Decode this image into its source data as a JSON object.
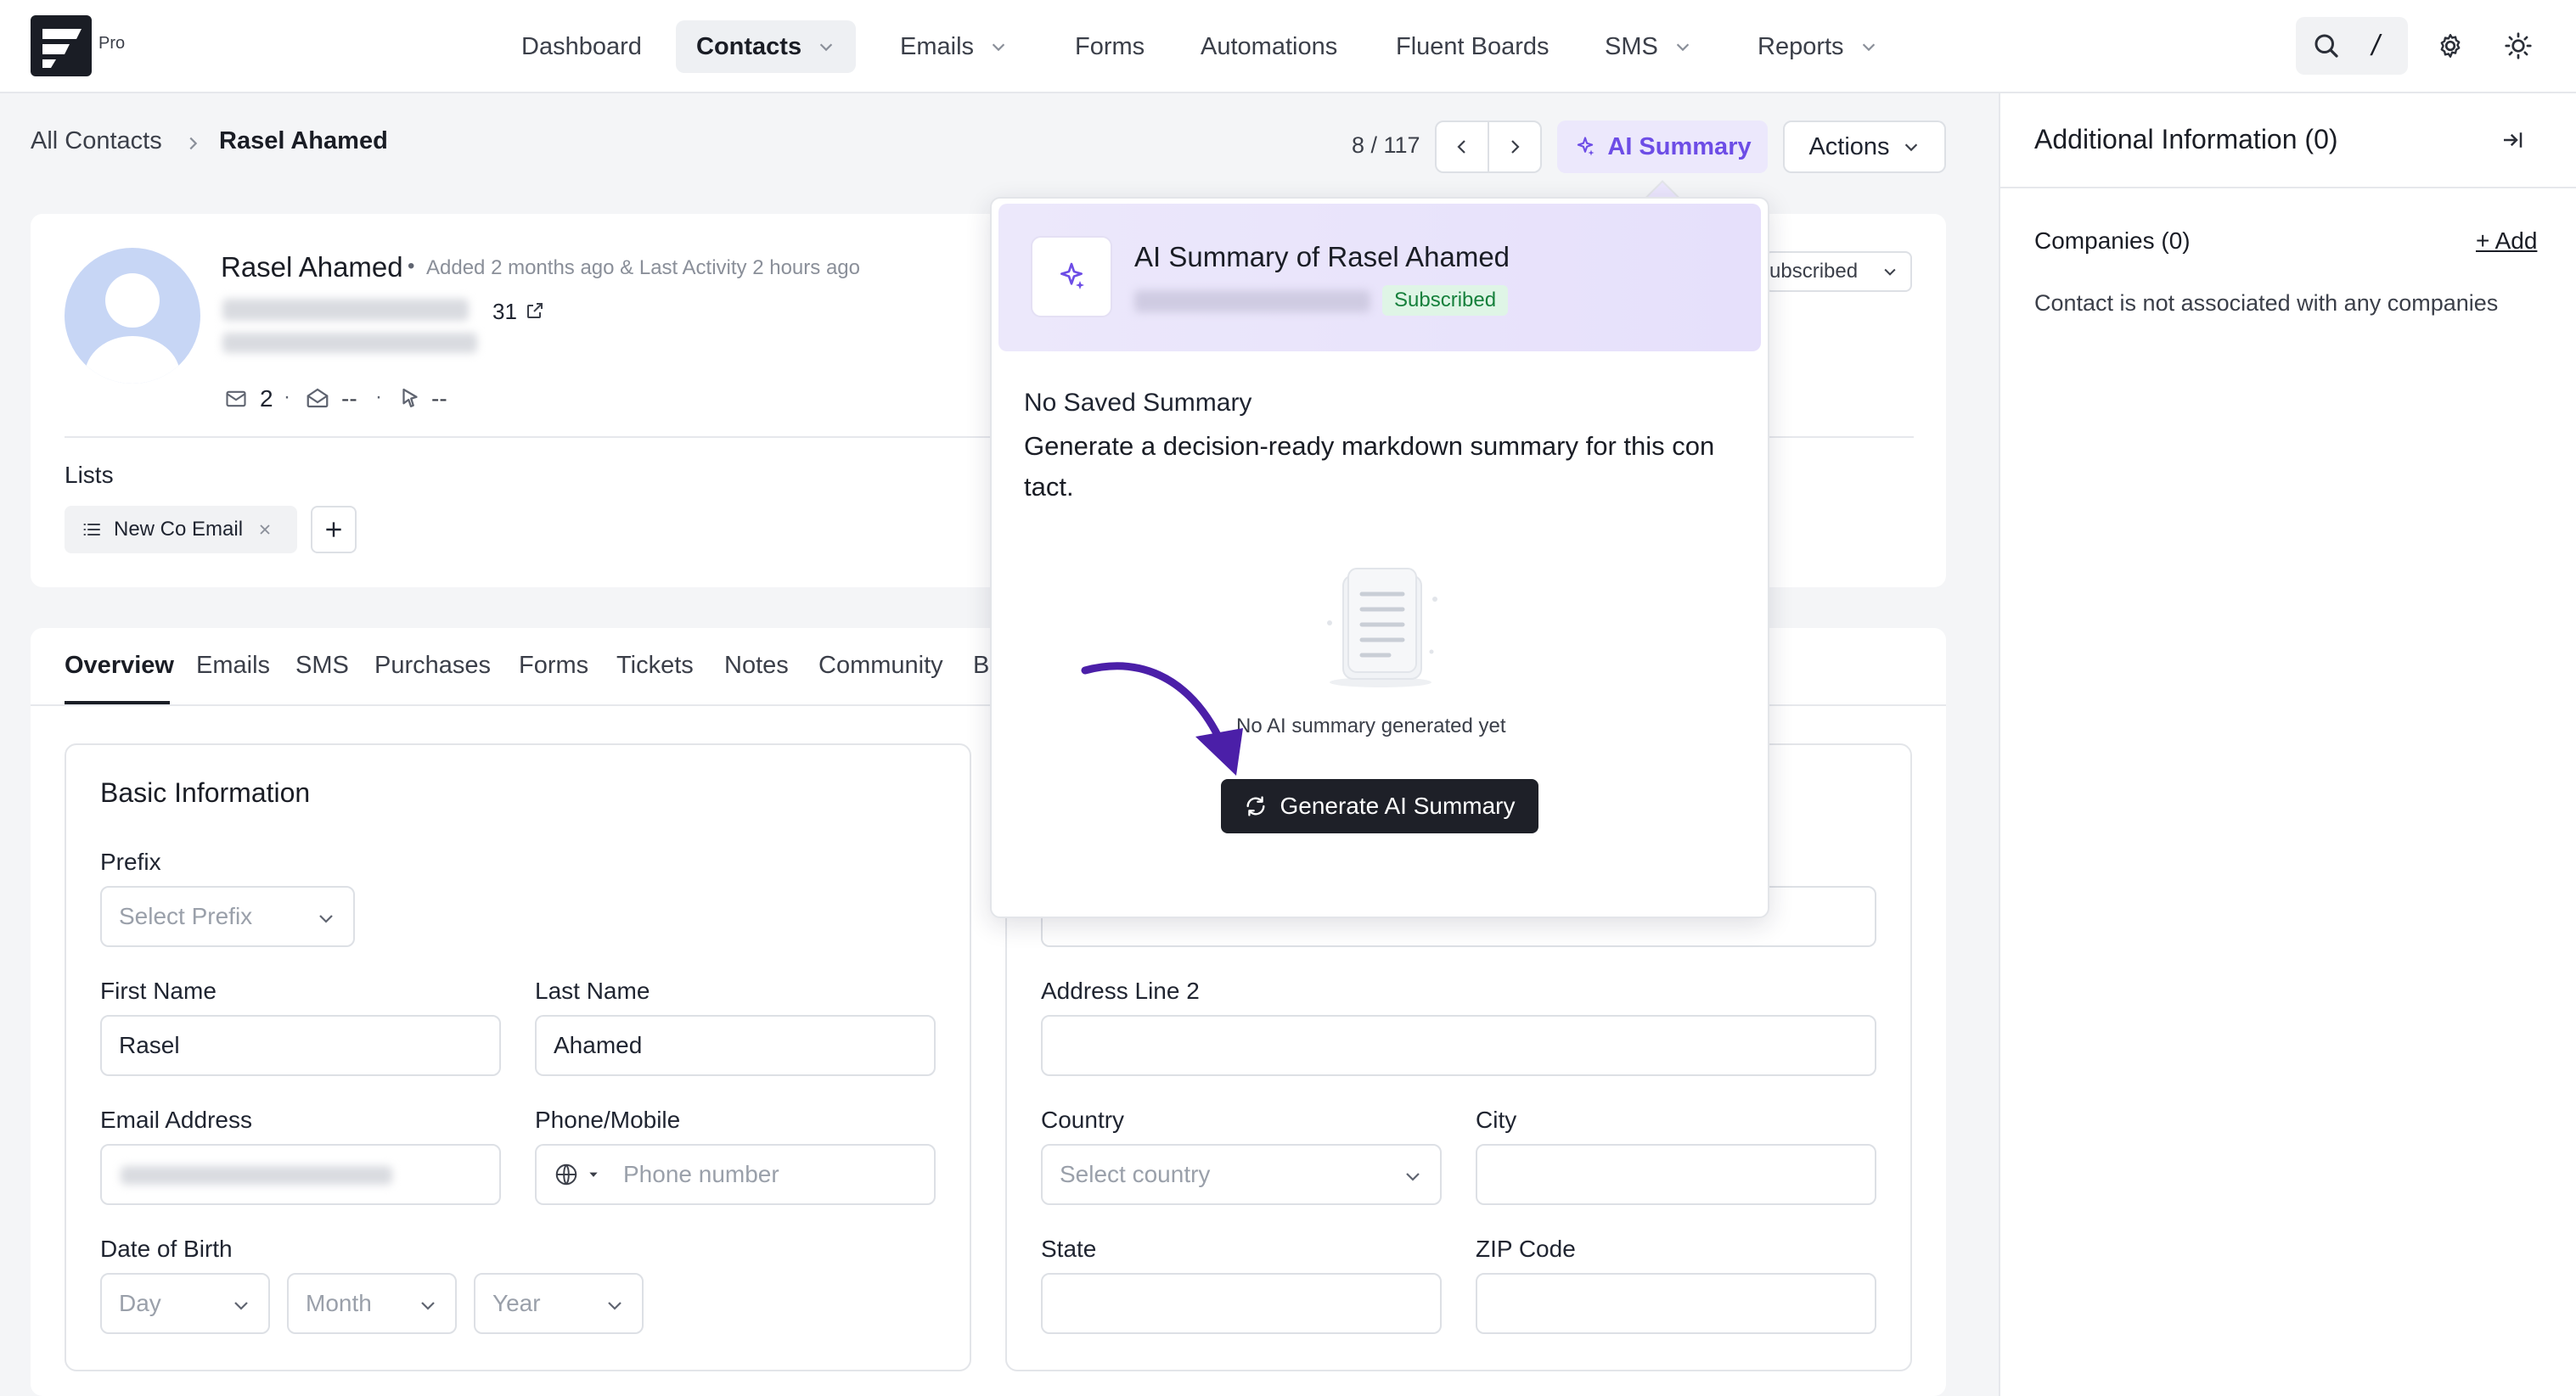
{
  "app": {
    "logo_badge": "Pro"
  },
  "nav": {
    "items": [
      {
        "label": "Dashboard",
        "has_dropdown": false
      },
      {
        "label": "Contacts",
        "has_dropdown": true,
        "active": true
      },
      {
        "label": "Emails",
        "has_dropdown": true
      },
      {
        "label": "Forms",
        "has_dropdown": false
      },
      {
        "label": "Automations",
        "has_dropdown": false
      },
      {
        "label": "Fluent Boards",
        "has_dropdown": false
      },
      {
        "label": "SMS",
        "has_dropdown": true
      },
      {
        "label": "Reports",
        "has_dropdown": true
      }
    ],
    "tools": [
      "search-icon",
      "slash-shortcut-icon",
      "gear-icon",
      "sun-icon"
    ],
    "slash_glyph": "/"
  },
  "breadcrumb": {
    "root": "All Contacts",
    "current": "Rasel Ahamed"
  },
  "pager": {
    "text": "8 / 117"
  },
  "toolbar": {
    "ai_summary_label": "AI Summary",
    "actions_label": "Actions"
  },
  "contact": {
    "name": "Rasel Ahamed",
    "meta": "Added 2 months ago & Last Activity 2 hours ago",
    "age_value": "31",
    "stats": {
      "emails": "2",
      "opens": "--",
      "clicks": "--"
    },
    "status_partial": "ubscribed"
  },
  "lists": {
    "heading": "Lists",
    "items": [
      "New Co Email"
    ]
  },
  "tabs": [
    "Overview",
    "Emails",
    "SMS",
    "Purchases",
    "Forms",
    "Tickets",
    "Notes",
    "Community",
    "B"
  ],
  "basic_info": {
    "heading": "Basic Information",
    "prefix": {
      "label": "Prefix",
      "placeholder": "Select Prefix"
    },
    "first_name": {
      "label": "First Name",
      "value": "Rasel"
    },
    "last_name": {
      "label": "Last Name",
      "value": "Ahamed"
    },
    "email": {
      "label": "Email Address"
    },
    "phone": {
      "label": "Phone/Mobile",
      "placeholder": "Phone number"
    },
    "dob": {
      "label": "Date of Birth",
      "day": "Day",
      "month": "Month",
      "year": "Year"
    }
  },
  "address": {
    "address_line_2": {
      "label": "Address Line 2"
    },
    "country": {
      "label": "Country",
      "placeholder": "Select country"
    },
    "city": {
      "label": "City"
    },
    "state": {
      "label": "State"
    },
    "zip": {
      "label": "ZIP Code"
    }
  },
  "sidebar": {
    "title": "Additional Information (0)",
    "companies_label": "Companies (0)",
    "add_label": "+ Add",
    "empty_text": "Contact is not associated with any companies"
  },
  "ai_popup": {
    "title": "AI Summary of Rasel Ahamed",
    "status_badge": "Subscribed",
    "no_saved_heading": "No Saved Summary",
    "description_line1": "Generate a decision-ready markdown summary for this con",
    "description_line2": "tact.",
    "empty_state": "No AI summary generated yet",
    "generate_label": "Generate AI Summary"
  },
  "colors": {
    "accent_purple": "#6d4de6",
    "annotation_arrow": "#4b1fa8",
    "subscribed_green": "#16803c",
    "dark_button": "#1e2028"
  }
}
